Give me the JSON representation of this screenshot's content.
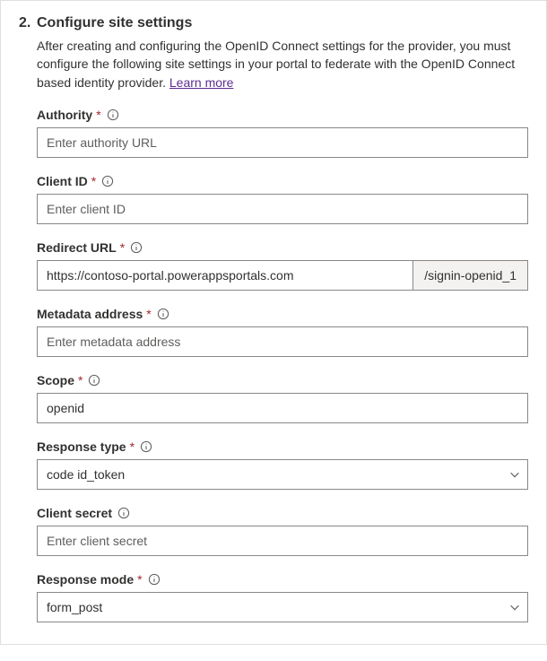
{
  "step": {
    "number": "2.",
    "title": "Configure site settings",
    "description": "After creating and configuring the OpenID Connect settings for the provider, you must configure the following site settings in your portal to federate with the OpenID Connect based identity provider. ",
    "learn_more": "Learn more"
  },
  "fields": {
    "authority": {
      "label": "Authority",
      "required": "*",
      "placeholder": "Enter authority URL",
      "value": ""
    },
    "client_id": {
      "label": "Client ID",
      "required": "*",
      "placeholder": "Enter client ID",
      "value": ""
    },
    "redirect_url": {
      "label": "Redirect URL",
      "required": "*",
      "value": "https://contoso-portal.powerappsportals.com",
      "suffix": "/signin-openid_1"
    },
    "metadata_address": {
      "label": "Metadata address",
      "required": "*",
      "placeholder": "Enter metadata address",
      "value": ""
    },
    "scope": {
      "label": "Scope",
      "required": "*",
      "value": "openid"
    },
    "response_type": {
      "label": "Response type",
      "required": "*",
      "value": "code id_token"
    },
    "client_secret": {
      "label": "Client secret",
      "placeholder": "Enter client secret",
      "value": ""
    },
    "response_mode": {
      "label": "Response mode",
      "required": "*",
      "value": "form_post"
    }
  }
}
